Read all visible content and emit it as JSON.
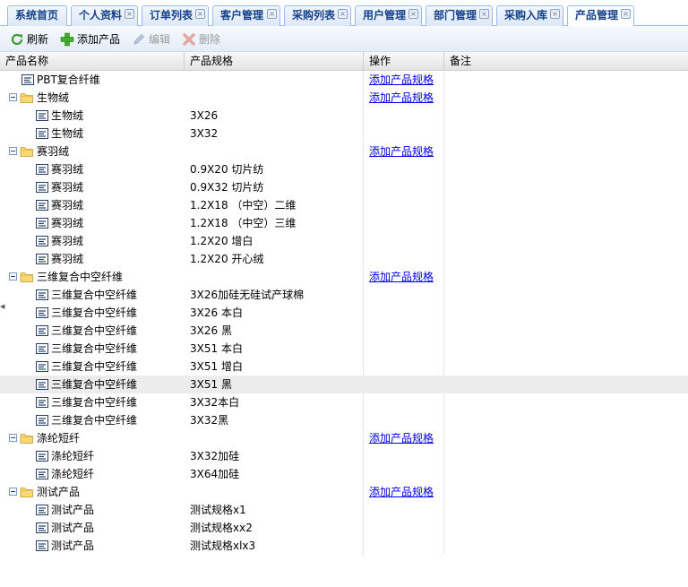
{
  "tabs": [
    {
      "label": "系统首页",
      "closable": false
    },
    {
      "label": "个人资料",
      "closable": true
    },
    {
      "label": "订单列表",
      "closable": true
    },
    {
      "label": "客户管理",
      "closable": true
    },
    {
      "label": "采购列表",
      "closable": true
    },
    {
      "label": "用户管理",
      "closable": true
    },
    {
      "label": "部门管理",
      "closable": true
    },
    {
      "label": "采购入库",
      "closable": true
    },
    {
      "label": "产品管理",
      "closable": true,
      "active": true
    }
  ],
  "toolbar": {
    "refresh_label": "刷新",
    "add_label": "添加产品",
    "edit_label": "编辑",
    "delete_label": "删除"
  },
  "columns": {
    "name": "产品名称",
    "spec": "产品规格",
    "op": "操作",
    "note": "备注"
  },
  "op_link_text": "添加产品规格",
  "rows": [
    {
      "type": "leaf",
      "level": 0,
      "name": "PBT复合纤维",
      "spec": "",
      "op": true
    },
    {
      "type": "group",
      "level": 0,
      "name": "生物绒",
      "spec": "",
      "op": true
    },
    {
      "type": "leaf",
      "level": 1,
      "name": "生物绒",
      "spec": "3X26",
      "op": false
    },
    {
      "type": "leaf",
      "level": 1,
      "name": "生物绒",
      "spec": "3X32",
      "op": false
    },
    {
      "type": "group",
      "level": 0,
      "name": "赛羽绒",
      "spec": "",
      "op": true
    },
    {
      "type": "leaf",
      "level": 1,
      "name": "赛羽绒",
      "spec": "0.9X20 切片纺",
      "op": false
    },
    {
      "type": "leaf",
      "level": 1,
      "name": "赛羽绒",
      "spec": "0.9X32 切片纺",
      "op": false
    },
    {
      "type": "leaf",
      "level": 1,
      "name": "赛羽绒",
      "spec": "1.2X18 （中空）二维",
      "op": false
    },
    {
      "type": "leaf",
      "level": 1,
      "name": "赛羽绒",
      "spec": "1.2X18 （中空）三维",
      "op": false
    },
    {
      "type": "leaf",
      "level": 1,
      "name": "赛羽绒",
      "spec": "1.2X20 增白",
      "op": false
    },
    {
      "type": "leaf",
      "level": 1,
      "name": "赛羽绒",
      "spec": "1.2X20 开心绒",
      "op": false
    },
    {
      "type": "group",
      "level": 0,
      "name": "三维复合中空纤维",
      "spec": "",
      "op": true
    },
    {
      "type": "leaf",
      "level": 1,
      "name": "三维复合中空纤维",
      "spec": "3X26加硅无硅试产球棉",
      "op": false
    },
    {
      "type": "leaf",
      "level": 1,
      "name": "三维复合中空纤维",
      "spec": "3X26 本白",
      "op": false
    },
    {
      "type": "leaf",
      "level": 1,
      "name": "三维复合中空纤维",
      "spec": "3X26 黑",
      "op": false
    },
    {
      "type": "leaf",
      "level": 1,
      "name": "三维复合中空纤维",
      "spec": "3X51 本白",
      "op": false
    },
    {
      "type": "leaf",
      "level": 1,
      "name": "三维复合中空纤维",
      "spec": "3X51 增白",
      "op": false
    },
    {
      "type": "leaf",
      "level": 1,
      "name": "三维复合中空纤维",
      "spec": "3X51 黑",
      "op": false,
      "selected": true
    },
    {
      "type": "leaf",
      "level": 1,
      "name": "三维复合中空纤维",
      "spec": "3X32本白",
      "op": false
    },
    {
      "type": "leaf",
      "level": 1,
      "name": "三维复合中空纤维",
      "spec": "3X32黑",
      "op": false
    },
    {
      "type": "group",
      "level": 0,
      "name": "涤纶短纤",
      "spec": "",
      "op": true
    },
    {
      "type": "leaf",
      "level": 1,
      "name": "涤纶短纤",
      "spec": "3X32加硅",
      "op": false
    },
    {
      "type": "leaf",
      "level": 1,
      "name": "涤纶短纤",
      "spec": "3X64加硅",
      "op": false
    },
    {
      "type": "group",
      "level": 0,
      "name": "测试产品",
      "spec": "",
      "op": true
    },
    {
      "type": "leaf",
      "level": 1,
      "name": "测试产品",
      "spec": "测试规格x1",
      "op": false
    },
    {
      "type": "leaf",
      "level": 1,
      "name": "测试产品",
      "spec": "测试规格xx2",
      "op": false
    },
    {
      "type": "leaf",
      "level": 1,
      "name": "测试产品",
      "spec": "测试规格xlx3",
      "op": false
    }
  ]
}
